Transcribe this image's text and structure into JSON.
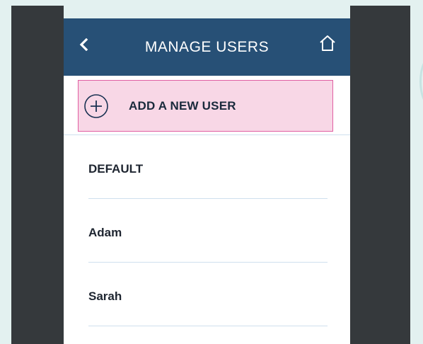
{
  "header": {
    "title": "MANAGE USERS",
    "back_icon": "chevron-left-icon",
    "home_icon": "home-icon",
    "background": "#275076"
  },
  "add_user": {
    "label": "ADD A NEW USER",
    "icon": "plus-circle-icon",
    "background": "#f8d7e6",
    "border": "#e05fa2"
  },
  "users": [
    {
      "name": "DEFAULT"
    },
    {
      "name": "Adam"
    },
    {
      "name": "Sarah"
    }
  ]
}
